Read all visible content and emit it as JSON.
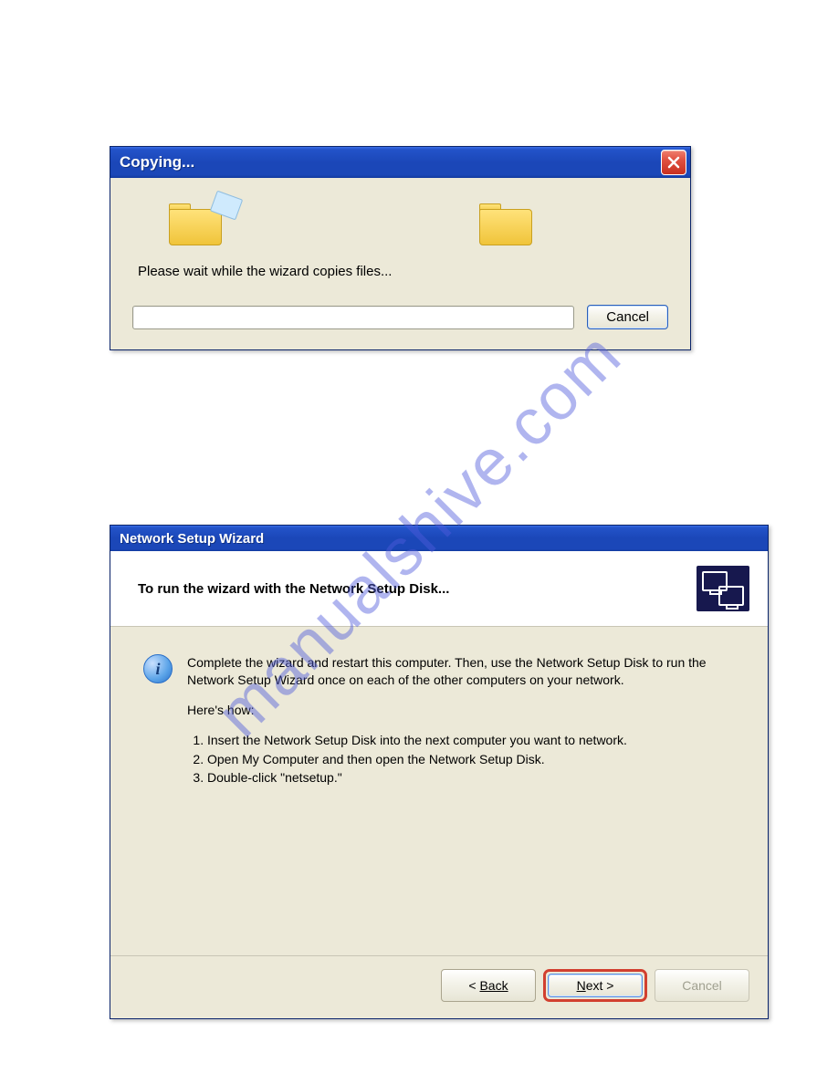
{
  "watermark": "manualshive.com",
  "dialog_copy": {
    "title": "Copying...",
    "message": "Please wait while the wizard copies files...",
    "cancel_label": "Cancel"
  },
  "dialog_wizard": {
    "title": "Network Setup Wizard",
    "header_title": "To run the wizard with the Network Setup Disk...",
    "intro": "Complete the wizard and restart this computer. Then, use the Network Setup Disk to run the Network Setup Wizard once on each of the other computers on your network.",
    "heres_how": "Here's how:",
    "steps": [
      "Insert the Network Setup Disk into the next computer you want to network.",
      "Open My Computer and then open the Network Setup Disk.",
      "Double-click \"netsetup.\""
    ],
    "back_label": "Back",
    "next_label": "Next >",
    "cancel_label": "Cancel",
    "info_glyph": "i"
  }
}
